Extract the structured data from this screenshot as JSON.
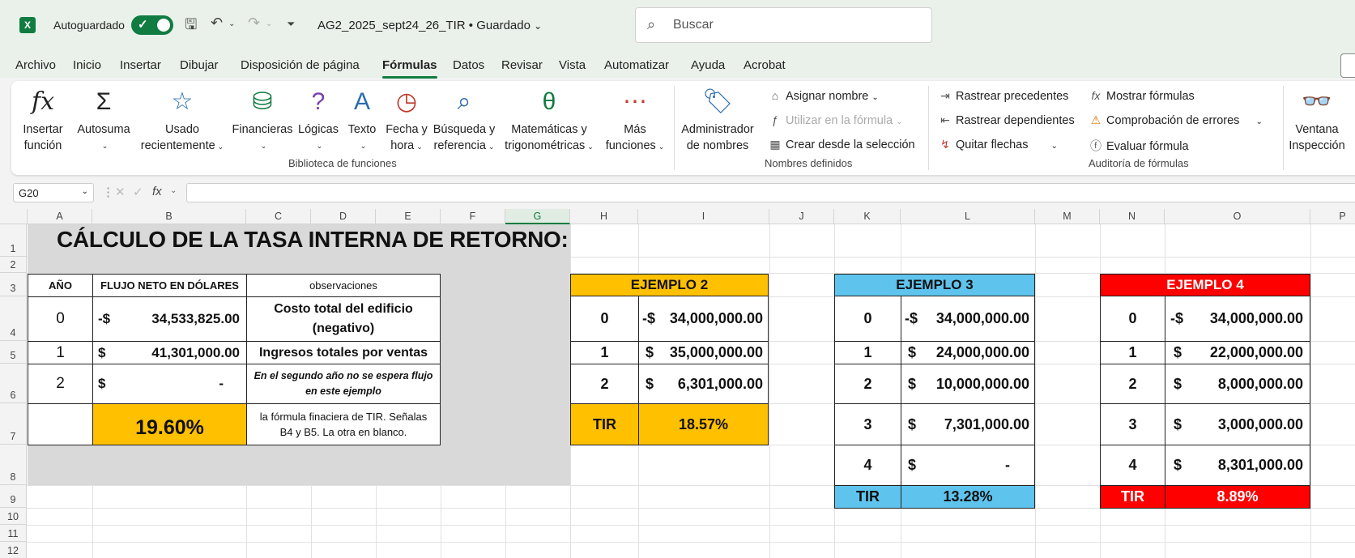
{
  "titlebar": {
    "app_icon": "X",
    "autosave_label": "Autoguardado",
    "doc_title": "AG2_2025_sept24_26_TIR • Guardado",
    "search_placeholder": "Buscar"
  },
  "tabs": [
    "Archivo",
    "Inicio",
    "Insertar",
    "Dibujar",
    "Disposición de página",
    "Fórmulas",
    "Datos",
    "Revisar",
    "Vista",
    "Automatizar",
    "Ayuda",
    "Acrobat"
  ],
  "active_tab": "Fórmulas",
  "ribbon": {
    "insert_function": [
      "Insertar",
      "función"
    ],
    "autosum": "Autosuma",
    "recent": [
      "Usado",
      "recientemente"
    ],
    "financial": "Financieras",
    "logical": "Lógicas",
    "text": "Texto",
    "datetime": [
      "Fecha y",
      "hora"
    ],
    "lookup": [
      "Búsqueda y",
      "referencia"
    ],
    "math": [
      "Matemáticas y",
      "trigonométricas"
    ],
    "more": [
      "Más",
      "funciones"
    ],
    "group_library": "Biblioteca de funciones",
    "name_manager": [
      "Administrador",
      "de nombres"
    ],
    "define_name": "Asignar nombre",
    "use_in_formula": "Utilizar en la fórmula",
    "create_from_sel": "Crear desde la selección",
    "group_names": "Nombres definidos",
    "trace_prec": "Rastrear precedentes",
    "trace_dep": "Rastrear dependientes",
    "remove_arrows": "Quitar flechas",
    "show_formulas": "Mostrar fórmulas",
    "error_check": "Comprobación de errores",
    "evaluate": "Evaluar fórmula",
    "group_audit": "Auditoría de fórmulas",
    "watch": [
      "Ventana",
      "Inspección"
    ]
  },
  "formula_bar": {
    "name_box": "G20",
    "fx": "fx",
    "content": ""
  },
  "columns": [
    "A",
    "B",
    "C",
    "D",
    "E",
    "F",
    "G",
    "H",
    "I",
    "J",
    "K",
    "L",
    "M",
    "N",
    "O",
    "P"
  ],
  "rows": [
    "1",
    "2",
    "3",
    "4",
    "5",
    "6",
    "7",
    "8",
    "9",
    "10",
    "11",
    "12"
  ],
  "sheet": {
    "title": "CÁLCULO DE LA TASA INTERNA DE RETORNO:",
    "main": {
      "hdr_year": "AÑO",
      "hdr_flow": "FLUJO NETO EN DÓLARES",
      "hdr_obs": "observaciones",
      "r0": {
        "year": "0",
        "sign": "-$",
        "amount": "34,533,825.00",
        "obs": "Costo total del edificio (negativo)"
      },
      "r1": {
        "year": "1",
        "sign": "$",
        "amount": "41,301,000.00",
        "obs": "Ingresos totales por ventas"
      },
      "r2": {
        "year": "2",
        "sign": "$",
        "amount": "-",
        "obs": "En el segundo año no se espera flujo en este ejemplo"
      },
      "result": "19.60%",
      "result_note": "la fórmula finaciera de TIR. Señalas B4 y B5. La otra en blanco."
    },
    "ex2": {
      "title": "EJEMPLO 2",
      "rows": [
        {
          "n": "0",
          "sign": "-$",
          "amount": "34,000,000.00"
        },
        {
          "n": "1",
          "sign": "$",
          "amount": "35,000,000.00"
        },
        {
          "n": "2",
          "sign": "$",
          "amount": "6,301,000.00"
        }
      ],
      "tir_label": "TIR",
      "tir_value": "18.57%"
    },
    "ex3": {
      "title": "EJEMPLO 3",
      "rows": [
        {
          "n": "0",
          "sign": "-$",
          "amount": "34,000,000.00"
        },
        {
          "n": "1",
          "sign": "$",
          "amount": "24,000,000.00"
        },
        {
          "n": "2",
          "sign": "$",
          "amount": "10,000,000.00"
        },
        {
          "n": "3",
          "sign": "$",
          "amount": "7,301,000.00"
        },
        {
          "n": "4",
          "sign": "$",
          "amount": "-"
        }
      ],
      "tir_label": "TIR",
      "tir_value": "13.28%"
    },
    "ex4": {
      "title": "EJEMPLO 4",
      "rows": [
        {
          "n": "0",
          "sign": "-$",
          "amount": "34,000,000.00"
        },
        {
          "n": "1",
          "sign": "$",
          "amount": "22,000,000.00"
        },
        {
          "n": "2",
          "sign": "$",
          "amount": "8,000,000.00"
        },
        {
          "n": "3",
          "sign": "$",
          "amount": "3,000,000.00"
        },
        {
          "n": "4",
          "sign": "$",
          "amount": "8,301,000.00"
        }
      ],
      "tir_label": "TIR",
      "tir_value": "8.89%"
    }
  }
}
